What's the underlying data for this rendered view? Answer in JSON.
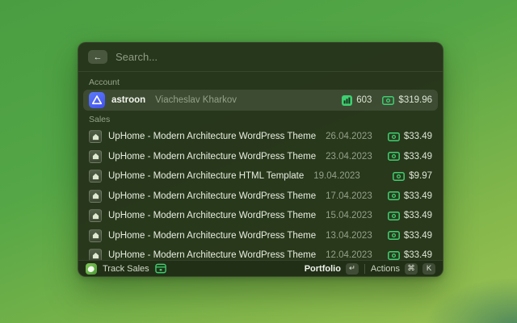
{
  "colors": {
    "accent_green": "#3ecf71",
    "avatar_blue": "#4b5ef2",
    "wallpaper_green_top": "#4a9e41",
    "wallpaper_green_bottom": "#9ac253",
    "panel_background": "#263419"
  },
  "window": {
    "search": {
      "placeholder": "Search...",
      "back_icon": "←"
    },
    "account_section": {
      "label": "Account",
      "account": {
        "username": "astroon",
        "full_name": "Viacheslav Kharkov",
        "sales_count": "603",
        "earnings": "$319.96"
      }
    },
    "sales_section": {
      "label": "Sales",
      "items": [
        {
          "title": "UpHome - Modern Architecture WordPress Theme",
          "date": "26.04.2023",
          "amount": "$33.49"
        },
        {
          "title": "UpHome - Modern Architecture WordPress Theme",
          "date": "23.04.2023",
          "amount": "$33.49"
        },
        {
          "title": "UpHome - Modern Architecture HTML Template",
          "date": "19.04.2023",
          "amount": "$9.97"
        },
        {
          "title": "UpHome - Modern Architecture WordPress Theme",
          "date": "17.04.2023",
          "amount": "$33.49"
        },
        {
          "title": "UpHome - Modern Architecture WordPress Theme",
          "date": "15.04.2023",
          "amount": "$33.49"
        },
        {
          "title": "UpHome - Modern Architecture WordPress Theme",
          "date": "13.04.2023",
          "amount": "$33.49"
        },
        {
          "title": "UpHome - Modern Architecture WordPress Theme",
          "date": "12.04.2023",
          "amount": "$33.49"
        }
      ]
    },
    "footer": {
      "extension_name": "Track Sales",
      "primary_action_label": "Portfolio",
      "primary_action_key": "↵",
      "actions_label": "Actions",
      "actions_key_modifier": "⌘",
      "actions_key_letter": "K"
    }
  }
}
